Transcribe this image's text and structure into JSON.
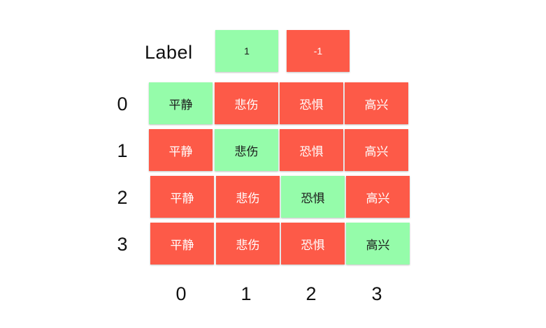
{
  "legend": {
    "title": "Label",
    "positive_label": "1",
    "negative_label": "-1",
    "positive_color": "#95fcaa",
    "negative_color": "#fd5a48"
  },
  "row_labels": [
    "0",
    "1",
    "2",
    "3"
  ],
  "col_labels": [
    "0",
    "1",
    "2",
    "3"
  ],
  "grid": {
    "rows": [
      {
        "cells": [
          {
            "text": "平静",
            "value": 1
          },
          {
            "text": "悲伤",
            "value": -1
          },
          {
            "text": "恐惧",
            "value": -1
          },
          {
            "text": "高兴",
            "value": -1
          }
        ]
      },
      {
        "cells": [
          {
            "text": "平静",
            "value": -1
          },
          {
            "text": "悲伤",
            "value": 1
          },
          {
            "text": "恐惧",
            "value": -1
          },
          {
            "text": "高兴",
            "value": -1
          }
        ]
      },
      {
        "cells": [
          {
            "text": "平静",
            "value": -1
          },
          {
            "text": "悲伤",
            "value": -1
          },
          {
            "text": "恐惧",
            "value": 1
          },
          {
            "text": "高兴",
            "value": -1
          }
        ]
      },
      {
        "cells": [
          {
            "text": "平静",
            "value": -1
          },
          {
            "text": "悲伤",
            "value": -1
          },
          {
            "text": "恐惧",
            "value": -1
          },
          {
            "text": "高兴",
            "value": 1
          }
        ]
      }
    ]
  }
}
